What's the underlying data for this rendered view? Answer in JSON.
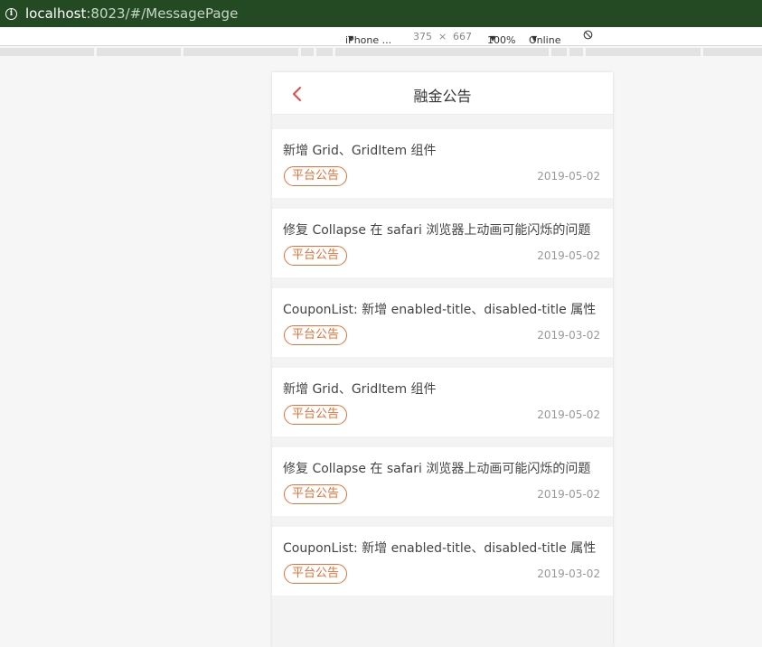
{
  "browser": {
    "url_host": "localhost",
    "url_rest": ":8023/#/MessagePage",
    "device": "iPhone ...",
    "width": "375",
    "times": "×",
    "height": "667",
    "zoom": "100%",
    "network": "Online"
  },
  "page": {
    "title": "融金公告"
  },
  "notices": [
    {
      "title": "新增 Grid、GridItem 组件",
      "tag": "平台公告",
      "date": "2019-05-02"
    },
    {
      "title": "修复 Collapse 在 safari 浏览器上动画可能闪烁的问题",
      "tag": "平台公告",
      "date": "2019-05-02"
    },
    {
      "title": "CouponList: 新增 enabled-title、disabled-title 属性",
      "tag": "平台公告",
      "date": "2019-03-02"
    },
    {
      "title": "新增 Grid、GridItem 组件",
      "tag": "平台公告",
      "date": "2019-05-02"
    },
    {
      "title": "修复 Collapse 在 safari 浏览器上动画可能闪烁的问题",
      "tag": "平台公告",
      "date": "2019-05-02"
    },
    {
      "title": "CouponList: 新增 enabled-title、disabled-title 属性",
      "tag": "平台公告",
      "date": "2019-03-02"
    }
  ],
  "colors": {
    "address_bar": "#244a23",
    "accent": "#e0733a",
    "back_arrow": "#e14b4b"
  }
}
